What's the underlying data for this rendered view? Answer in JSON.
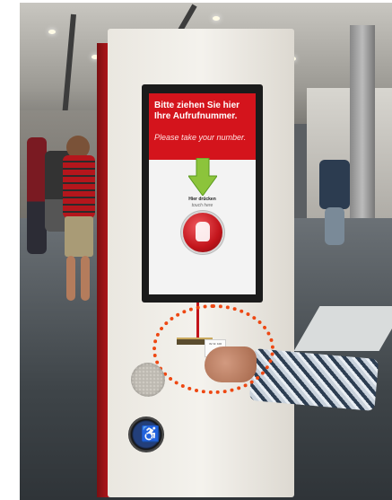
{
  "photo": {
    "screen": {
      "heading_line1": "Bitte ziehen Sie hier",
      "heading_line2": "Ihre Aufrufnummer.",
      "subheading": "Please take your number.",
      "press_here": "Hier drücken",
      "touch_here": "touch here",
      "accent_color": "#d4141c"
    },
    "ticket_text": "Ihr Nr. 100",
    "highlight_color": "#ee4712",
    "accessibility_icon": "wheelchair-icon"
  }
}
